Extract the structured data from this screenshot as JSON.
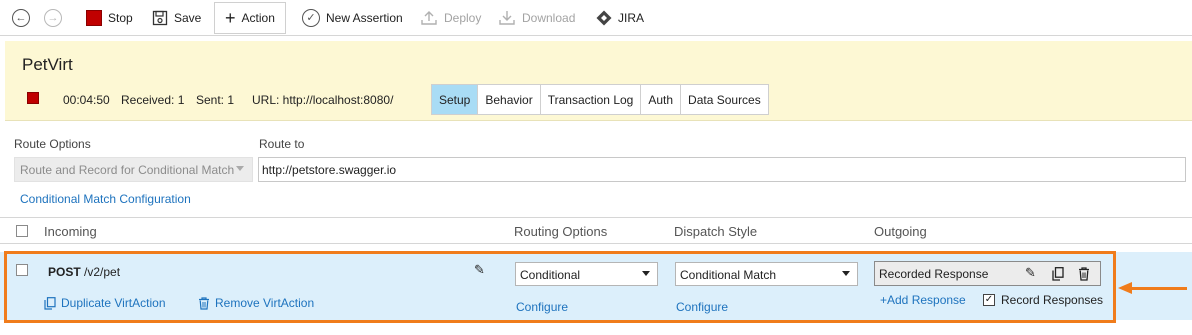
{
  "toolbar": {
    "back_icon": "arrow-left-circle",
    "forward_icon": "arrow-right-circle",
    "stop": "Stop",
    "save": "Save",
    "action": "Action",
    "new_assertion": "New Assertion",
    "deploy": "Deploy",
    "download": "Download",
    "jira": "JIRA"
  },
  "header": {
    "title": "PetVirt",
    "elapsed": "00:04:50",
    "received": "Received: 1",
    "sent": "Sent: 1",
    "url": "URL: http://localhost:8080/",
    "tabs": [
      "Setup",
      "Behavior",
      "Transaction Log",
      "Auth",
      "Data Sources"
    ],
    "active_tab": "Setup"
  },
  "route": {
    "options_label": "Route Options",
    "options_value": "Route and Record for Conditional Match",
    "route_to_label": "Route to",
    "route_to_value": "http://petstore.swagger.io",
    "conditional_link": "Conditional Match Configuration"
  },
  "table": {
    "columns": {
      "incoming": "Incoming",
      "routing_options": "Routing Options",
      "dispatch_style": "Dispatch Style",
      "outgoing": "Outgoing"
    },
    "row": {
      "method": "POST",
      "path": "/v2/pet",
      "duplicate": "Duplicate VirtAction",
      "remove": "Remove VirtAction",
      "routing_value": "Conditional",
      "routing_configure": "Configure",
      "dispatch_value": "Conditional Match",
      "dispatch_configure": "Configure",
      "outgoing_value": "Recorded Response",
      "add_response": "+Add Response",
      "record_responses": "Record Responses",
      "record_responses_checked": true
    }
  },
  "colors": {
    "accent_orange": "#f07c1b",
    "banner_bg": "#fdf8d4",
    "row_bg": "#dceffb",
    "active_tab": "#a9dcf5",
    "stop_red": "#c00000",
    "link_blue": "#1e73be"
  }
}
